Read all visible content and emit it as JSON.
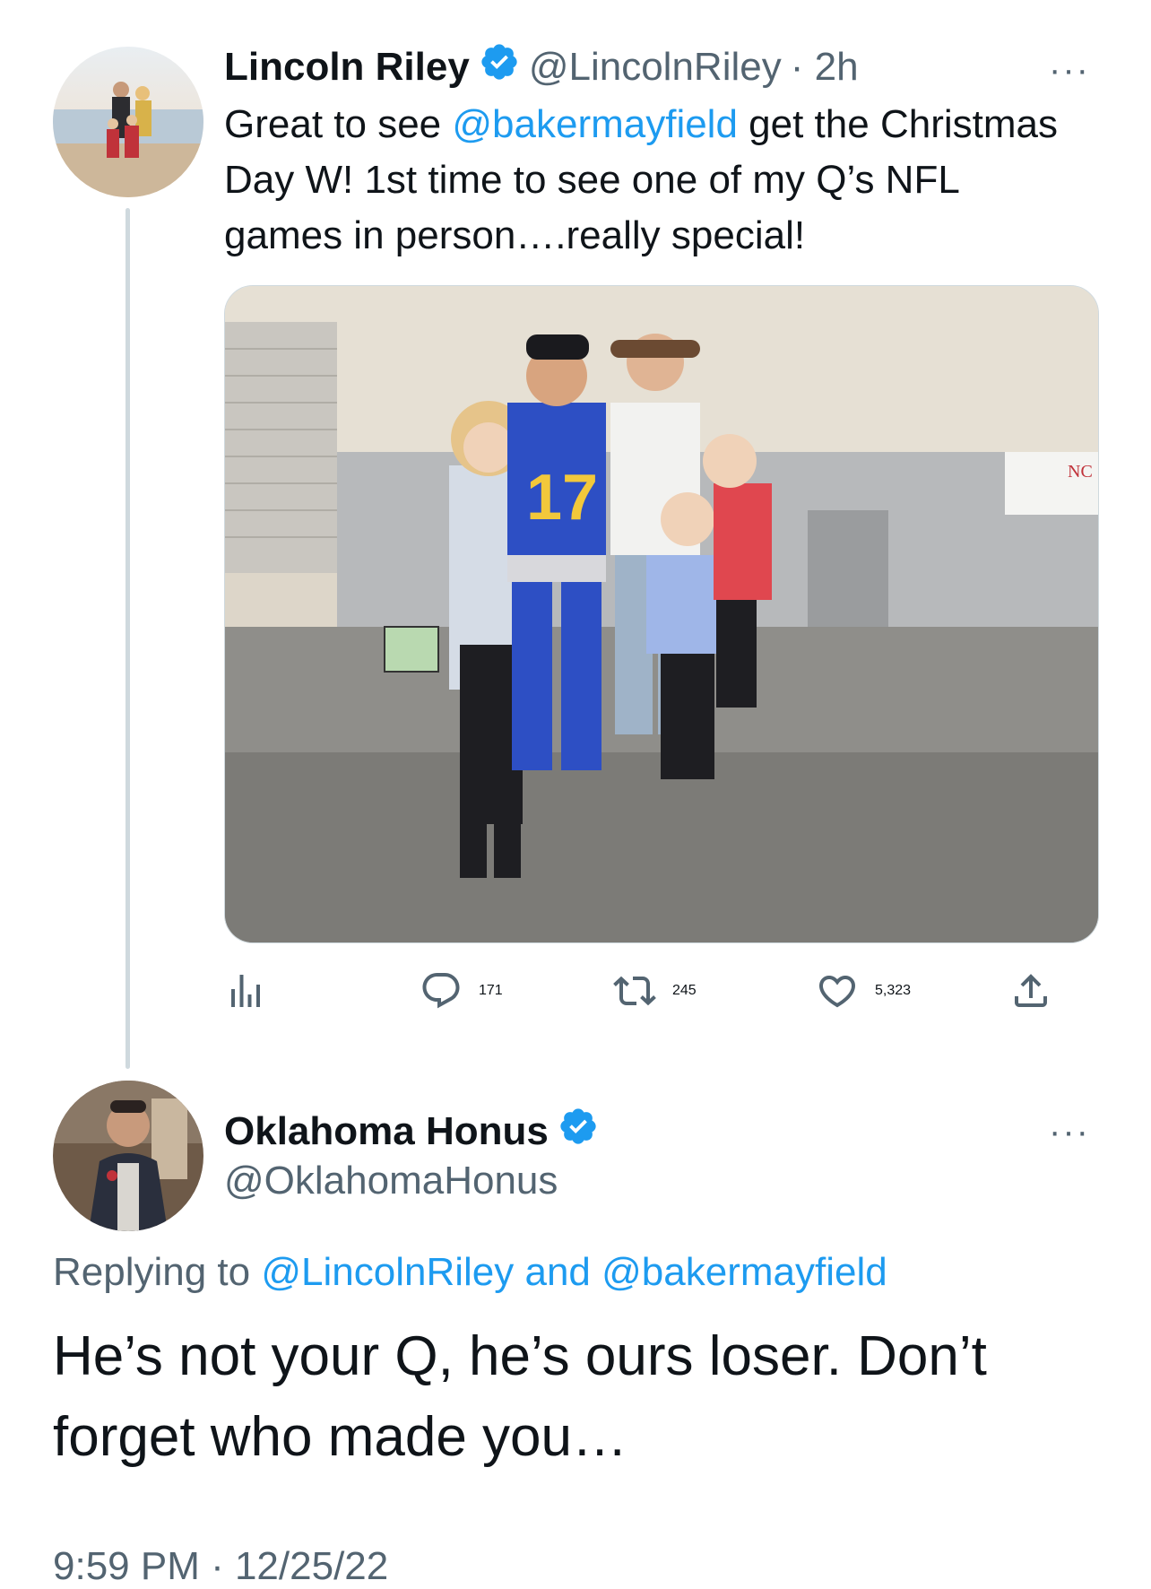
{
  "tweet": {
    "author_name": "Lincoln Riley",
    "author_handle": "@LincolnRiley",
    "time_ago": "· 2h",
    "more_label": "···",
    "text_before": "Great to see ",
    "mention": "@bakermayfield",
    "text_after": " get the Christmas Day W!  1st time to see one of my Q’s NFL games in person….really special!",
    "photo_alt": "Group photo of a family with a football player in jersey 17",
    "jersey_number": "17",
    "stats": {
      "replies": "171",
      "retweets": "245",
      "likes": "5,323"
    }
  },
  "reply": {
    "author_name": "Oklahoma Honus",
    "author_handle": "@OklahomaHonus",
    "more_label": "···",
    "replying_prefix": "Replying to ",
    "replying_mention_1": "@LincolnRiley",
    "replying_and": " and ",
    "replying_mention_2": "@bakermayfield",
    "text": "He’s not your Q, he’s ours loser. Don’t forget who made you…",
    "timestamp": "9:59 PM · 12/25/22"
  },
  "colors": {
    "accent": "#1d9bf0",
    "secondary_text": "#536471",
    "thread_line": "#cfd9de"
  },
  "icons": [
    "verified-badge-icon",
    "more-icon",
    "analytics-icon",
    "reply-icon",
    "retweet-icon",
    "like-icon",
    "share-icon"
  ]
}
